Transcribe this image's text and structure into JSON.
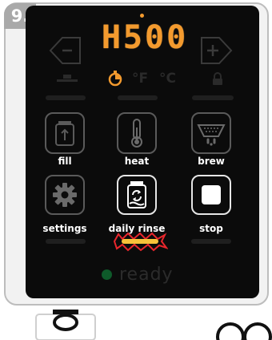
{
  "step": {
    "label": "9."
  },
  "display": {
    "digits": [
      "H",
      "5",
      "0",
      "0"
    ],
    "colon": ":"
  },
  "units": {
    "fahrenheit": "°F",
    "celsius": "°C"
  },
  "buttons": {
    "fill": {
      "label": "fill",
      "icon": "fill-tank-icon"
    },
    "heat": {
      "label": "heat",
      "icon": "thermometer-icon"
    },
    "brew": {
      "label": "brew",
      "icon": "brew-basket-icon"
    },
    "settings": {
      "label": "settings",
      "icon": "gear-icon"
    },
    "daily_rinse": {
      "label": "daily rinse",
      "icon": "rinse-cycle-icon"
    },
    "stop": {
      "label": "stop",
      "icon": "stop-square-icon"
    }
  },
  "status": {
    "ready_label": "ready"
  },
  "colors": {
    "accent_orange": "#f39a2e",
    "highlight_red": "#e8262c",
    "highlight_yellow": "#f7c23a",
    "panel": "#0b0b0b",
    "ready_dot": "#0e5a2a"
  }
}
